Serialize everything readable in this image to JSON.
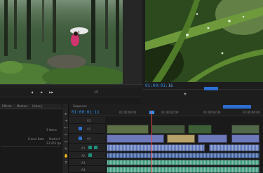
{
  "source": {
    "timecode": "",
    "frame_label": "1/2",
    "scene": "forest-with-pink-umbrella"
  },
  "program": {
    "timecode": "01:00:01:11",
    "fit": "Fit",
    "frame_label": "",
    "scene": "leaves-with-rain-drops"
  },
  "effects_panel": {
    "tabs": [
      "Effects",
      "Markers",
      "History"
    ],
    "rows": [
      {
        "label": "",
        "value": "3 Items"
      },
      {
        "label": "Frame Rate",
        "value": "Media S"
      },
      {
        "label": "",
        "value": "23.976 fps"
      }
    ]
  },
  "timeline": {
    "title": "Sequence",
    "timecode": "01:00:01:11",
    "ruler_labels": [
      "01:00:00:00",
      "01:00:02:00",
      "01:00:04:00",
      "01:00:06:00"
    ],
    "tracks": [
      {
        "name": "V3",
        "type": "video"
      },
      {
        "name": "V2",
        "type": "video"
      },
      {
        "name": "V1",
        "type": "video"
      },
      {
        "name": "A1",
        "type": "audio"
      },
      {
        "name": "A2",
        "type": "audio"
      },
      {
        "name": "A3",
        "type": "audio"
      },
      {
        "name": "A4",
        "type": "audio"
      }
    ]
  },
  "colors": {
    "accent_blue": "#2e8fe8",
    "video_clip": "#6e79b9",
    "audio_clip": "#3f9a7f",
    "playhead": "#e04545"
  },
  "icons": [
    "hand-tool-icon",
    "razor-icon",
    "selection-icon",
    "zoom-icon",
    "text-tool-icon",
    "play-icon",
    "step-forward-icon",
    "step-back-icon"
  ]
}
